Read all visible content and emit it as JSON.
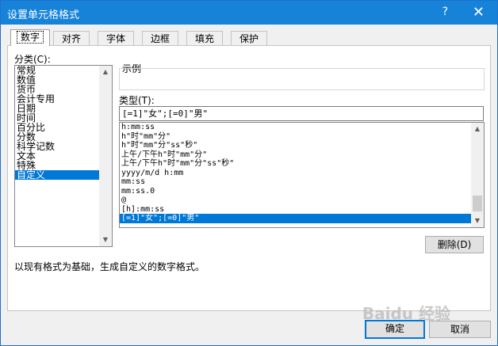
{
  "dialog": {
    "title": "设置单元格格式",
    "help": "?",
    "close": "✕"
  },
  "tabs": [
    "数字",
    "对齐",
    "字体",
    "边框",
    "填充",
    "保护"
  ],
  "category": {
    "label": "分类(C):",
    "items": [
      "常规",
      "数值",
      "货币",
      "会计专用",
      "日期",
      "时间",
      "百分比",
      "分数",
      "科学记数",
      "文本",
      "特殊",
      "自定义"
    ],
    "selected": "自定义"
  },
  "sample": {
    "label": "示例"
  },
  "type": {
    "label": "类型(T):",
    "value": "[=1]\"女\";[=0]\"男\"",
    "items": [
      "h:mm:ss",
      "h\"时\"mm\"分\"",
      "h\"时\"mm\"分\"ss\"秒\"",
      "上午/下午h\"时\"mm\"分\"",
      "上午/下午h\"时\"mm\"分\"ss\"秒\"",
      "yyyy/m/d h:mm",
      "mm:ss",
      "mm:ss.0",
      "@",
      "[h]:mm:ss",
      "[=1]\"女\";[=0]\"男\""
    ],
    "selected": "[=1]\"女\";[=0]\"男\""
  },
  "buttons": {
    "delete": "删除(D)",
    "ok": "确定",
    "cancel": "取消"
  },
  "description": "以现有格式为基础，生成自定义的数字格式。",
  "watermark": "Baidu 经验"
}
